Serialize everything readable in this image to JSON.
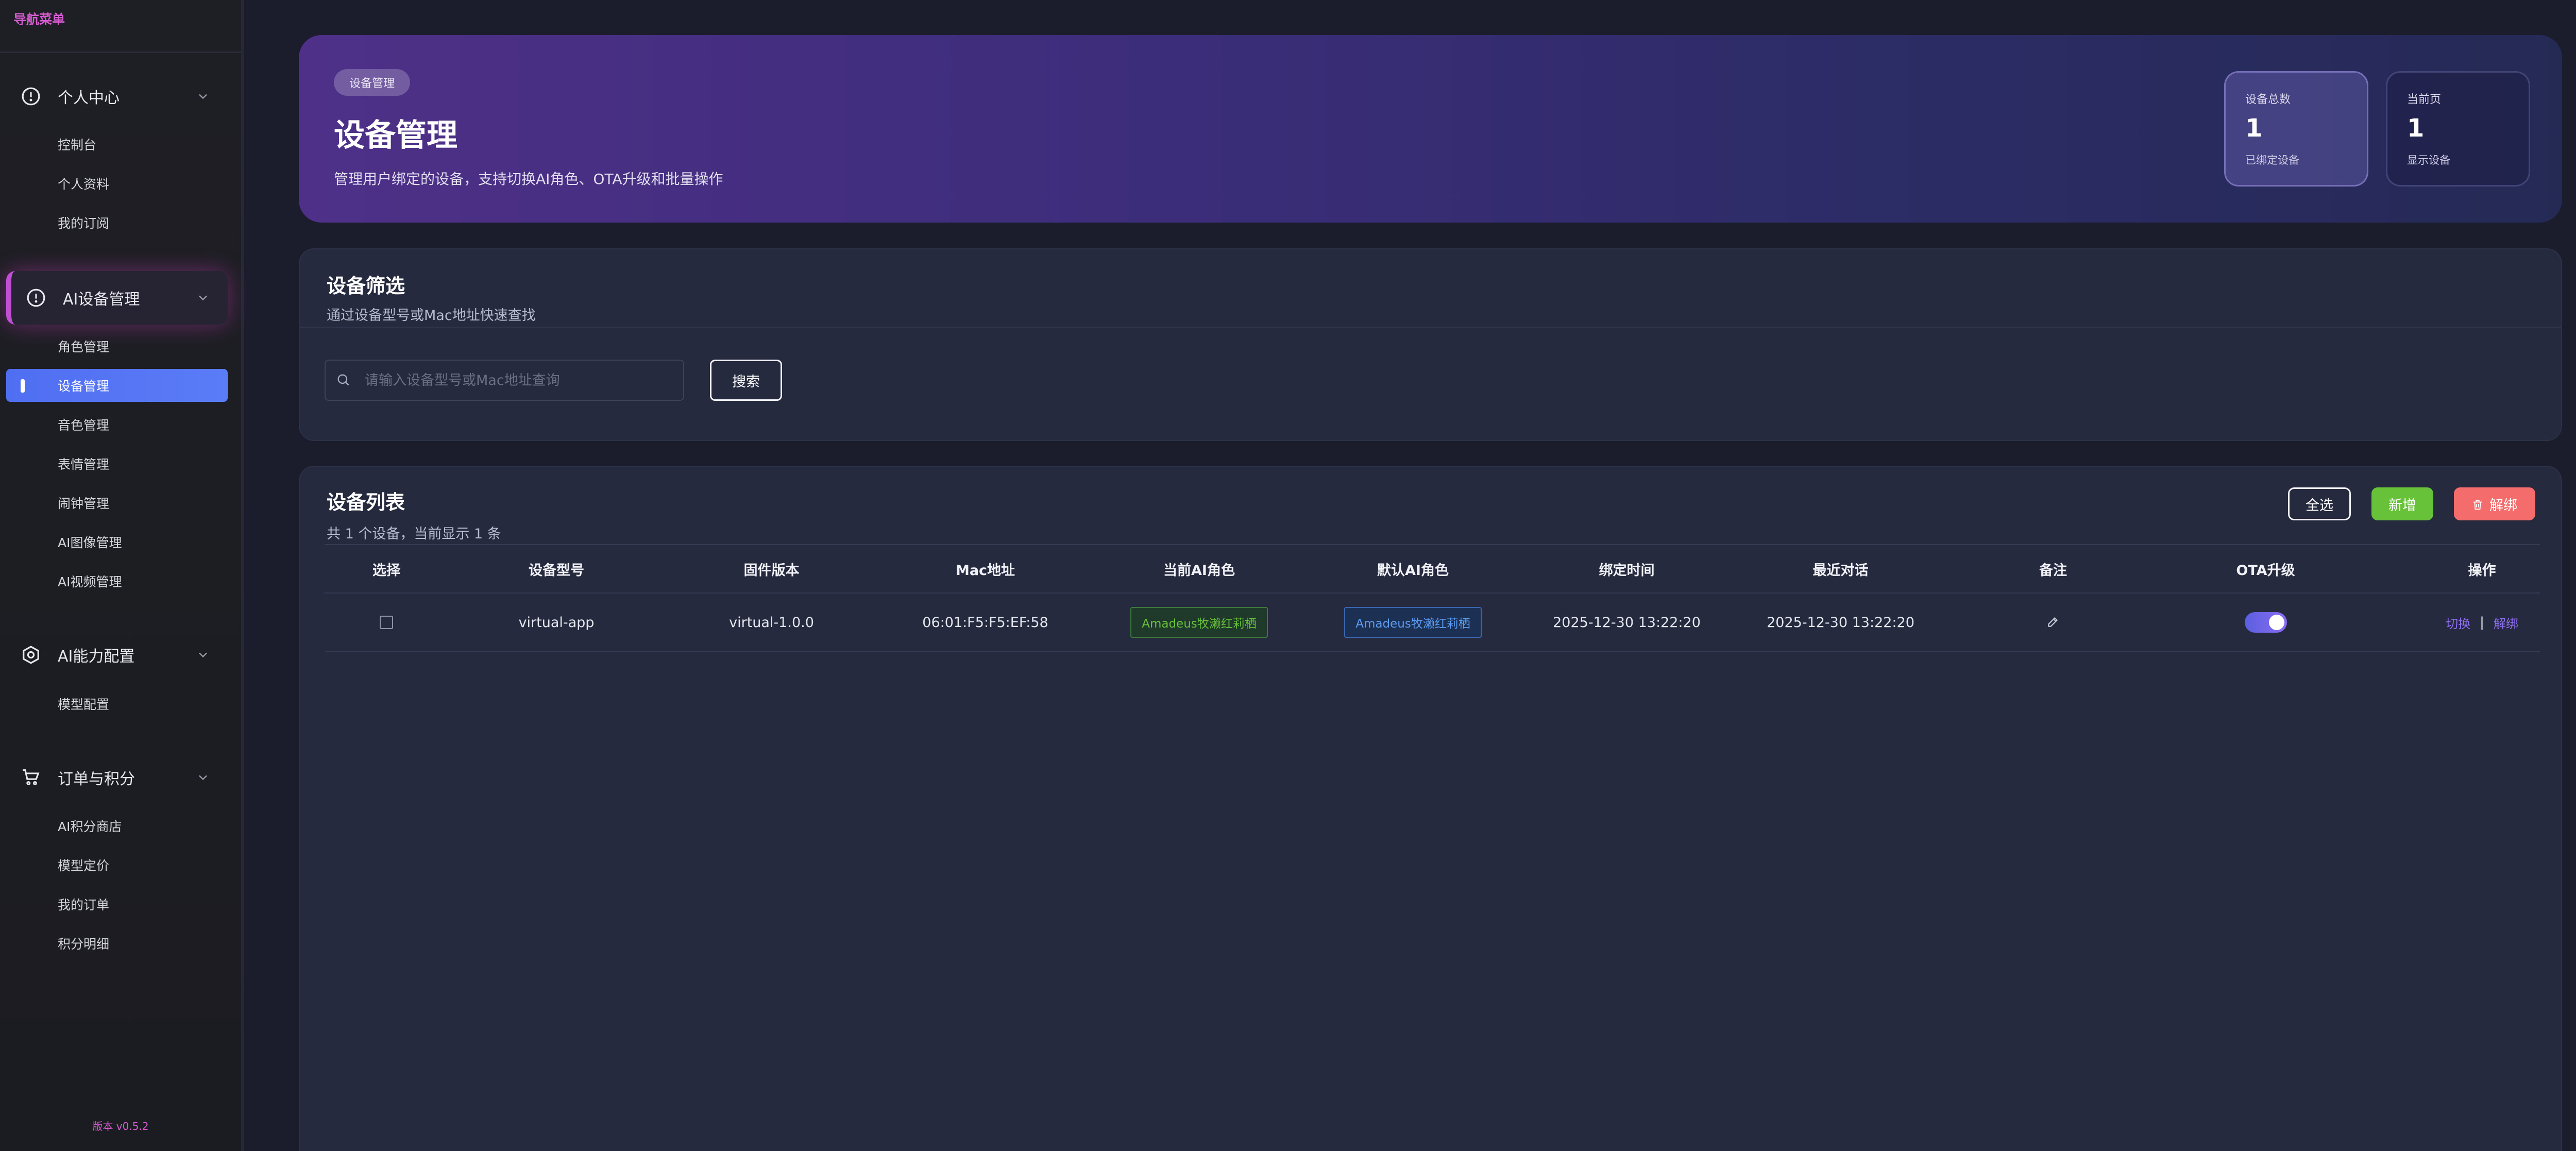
{
  "sidebar": {
    "nav_title": "导航菜单",
    "groups": [
      {
        "label": "个人中心",
        "items": [
          "控制台",
          "个人资料",
          "我的订阅"
        ]
      },
      {
        "label": "AI设备管理",
        "items": [
          "角色管理",
          "设备管理",
          "音色管理",
          "表情管理",
          "闹钟管理",
          "AI图像管理",
          "AI视频管理"
        ]
      },
      {
        "label": "AI能力配置",
        "items": [
          "模型配置"
        ]
      },
      {
        "label": "订单与积分",
        "items": [
          "AI积分商店",
          "模型定价",
          "我的订单",
          "积分明细"
        ]
      }
    ],
    "active_item": "设备管理",
    "version": "版本 v0.5.2"
  },
  "hero": {
    "badge": "设备管理",
    "title": "设备管理",
    "description": "管理用户绑定的设备，支持切换AI角色、OTA升级和批量操作",
    "stats": [
      {
        "label": "设备总数",
        "value": "1",
        "sub": "已绑定设备"
      },
      {
        "label": "当前页",
        "value": "1",
        "sub": "显示设备"
      }
    ]
  },
  "filter": {
    "title": "设备筛选",
    "subtitle": "通过设备型号或Mac地址快速查找",
    "search_placeholder": "请输入设备型号或Mac地址查询",
    "search_button": "搜索"
  },
  "list": {
    "title": "设备列表",
    "subtitle": "共 1 个设备，当前显示 1 条",
    "actions": {
      "select_all": "全选",
      "add": "新增",
      "unbind": "解绑"
    },
    "columns": [
      "选择",
      "设备型号",
      "固件版本",
      "Mac地址",
      "当前AI角色",
      "默认AI角色",
      "绑定时间",
      "最近对话",
      "备注",
      "OTA升级",
      "操作"
    ],
    "rows": [
      {
        "model": "virtual-app",
        "firmware": "virtual-1.0.0",
        "mac": "06:01:F5:F5:EF:58",
        "current_role": "Amadeus牧濑红莉栖",
        "default_role": "Amadeus牧濑红莉栖",
        "bind_time": "2025-12-30 13:22:20",
        "last_chat": "2025-12-30 13:22:20",
        "ota_enabled": true,
        "op_switch": "切换",
        "op_sep": "|",
        "op_unbind": "解绑"
      }
    ]
  },
  "colors": {
    "accent_purple": "#c14fd4",
    "active_blue": "#5b7cf7",
    "green": "#67c23a",
    "red": "#f56c6c",
    "link_purple": "#8f6ff4"
  }
}
